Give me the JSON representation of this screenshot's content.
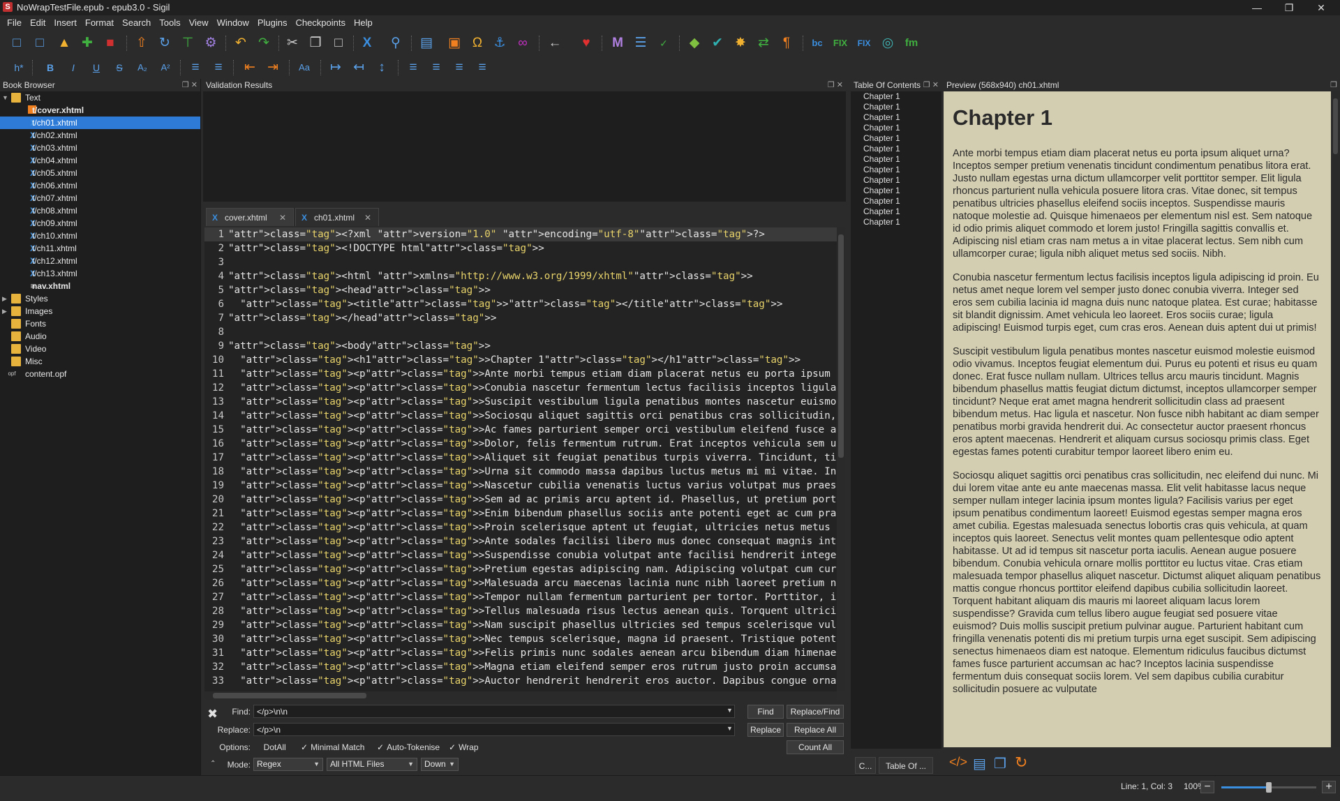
{
  "window": {
    "title": "NoWrapTestFile.epub - epub3.0 - Sigil",
    "app_icon": "S",
    "minimize": "—",
    "maximize": "❐",
    "close": "✕"
  },
  "menu": [
    "File",
    "Edit",
    "Insert",
    "Format",
    "Search",
    "Tools",
    "View",
    "Window",
    "Plugins",
    "Checkpoints",
    "Help"
  ],
  "toolbar1_icons": [
    "new-epub2-icon",
    "new-epub3-icon",
    "open-icon",
    "add-icon",
    "save-icon",
    "upload-icon",
    "redo-circle-icon",
    "insert-split-icon",
    "settings-icon",
    "undo-icon",
    "redo-icon",
    "cut-icon",
    "copy-icon",
    "paste-icon",
    "code-x-icon",
    "find-icon",
    "section-icon",
    "image-icon",
    "omega-icon",
    "anchor-icon",
    "link-icon",
    "back-icon",
    "donate-heart-icon",
    "metadata-m-icon",
    "list-icon",
    "spellcheck-icon",
    "validate-icon",
    "check-icon",
    "sun-icon",
    "reports-icon",
    "pilcrow-icon",
    "bc-icon",
    "fix-icon",
    "fix2-icon",
    "fingerprint-icon",
    "fm-icon"
  ],
  "toolbar2_icons": [
    "heading-icon",
    "bold-icon",
    "italic-icon",
    "underline-icon",
    "strikethrough-icon",
    "subscript-icon",
    "superscript-icon",
    "bullet-list-icon",
    "numbered-list-icon",
    "decrease-indent-icon",
    "increase-indent-icon",
    "case-icon",
    "ltr-icon",
    "rtl-icon",
    "text-direction-icon",
    "align-left-icon",
    "align-center-icon",
    "align-right-icon",
    "justify-icon"
  ],
  "toolbar2_text": {
    "heading": "h*",
    "bold": "B",
    "italic": "I",
    "underline": "U",
    "strike": "S",
    "sub": "A₂",
    "sup": "A²",
    "case": "Aa"
  },
  "book_browser": {
    "title": "Book Browser",
    "items": [
      {
        "type": "folder",
        "label": "Text",
        "expanded": true
      },
      {
        "type": "cover",
        "label": "t/cover.xhtml",
        "bold": true
      },
      {
        "type": "xhtml",
        "label": "t/ch01.xhtml",
        "selected": true
      },
      {
        "type": "xhtml",
        "label": "t/ch02.xhtml"
      },
      {
        "type": "xhtml",
        "label": "t/ch03.xhtml"
      },
      {
        "type": "xhtml",
        "label": "t/ch04.xhtml"
      },
      {
        "type": "xhtml",
        "label": "t/ch05.xhtml"
      },
      {
        "type": "xhtml",
        "label": "t/ch06.xhtml"
      },
      {
        "type": "xhtml",
        "label": "t/ch07.xhtml"
      },
      {
        "type": "xhtml",
        "label": "t/ch08.xhtml"
      },
      {
        "type": "xhtml",
        "label": "t/ch09.xhtml"
      },
      {
        "type": "xhtml",
        "label": "t/ch10.xhtml"
      },
      {
        "type": "xhtml",
        "label": "t/ch11.xhtml"
      },
      {
        "type": "xhtml",
        "label": "t/ch12.xhtml"
      },
      {
        "type": "xhtml",
        "label": "t/ch13.xhtml"
      },
      {
        "type": "nav",
        "label": "nav.xhtml",
        "bold": true
      },
      {
        "type": "folder",
        "label": "Styles",
        "collapsed": true
      },
      {
        "type": "folder",
        "label": "Images",
        "collapsed": true
      },
      {
        "type": "folder",
        "label": "Fonts"
      },
      {
        "type": "folder",
        "label": "Audio"
      },
      {
        "type": "folder",
        "label": "Video"
      },
      {
        "type": "folder",
        "label": "Misc"
      },
      {
        "type": "opf",
        "label": "content.opf"
      }
    ]
  },
  "validation": {
    "title": "Validation Results"
  },
  "editor": {
    "tabs": [
      {
        "label": "cover.xhtml",
        "active": false
      },
      {
        "label": "ch01.xhtml",
        "active": true
      }
    ],
    "lines": [
      "<?xml version=\"1.0\" encoding=\"utf-8\"?>",
      "<!DOCTYPE html>",
      "",
      "<html xmlns=\"http://www.w3.org/1999/xhtml\">",
      "<head>",
      "  <title></title>",
      "</head>",
      "",
      "<body>",
      "  <h1>Chapter 1</h1>",
      "  <p>Ante morbi tempus etiam diam placerat netus eu porta ipsum aliquet urna? Inceptos semper pre",
      "  <p>Conubia nascetur fermentum lectus facilisis inceptos ligula adipiscing id proin. Eu netus am",
      "  <p>Suscipit vestibulum ligula penatibus montes nascetur euismod molestie euismod odio vivamus.",
      "  <p>Sociosqu aliquet sagittis orci penatibus cras sollicitudin, nec eleifend dui nunc. Mi dui lo",
      "  <p>Ac fames parturient semper orci vestibulum eleifend fusce aptent eros. Tincidunt amet netus",
      "  <p>Dolor, felis fermentum rutrum. Erat inceptos vehicula sem ullamcorper justo laoreet. Magnis",
      "  <p>Aliquet sit feugiat penatibus turpis viverra. Tincidunt, tincidunt quis ornare pulvinar lore",
      "  <p>Urna sit commodo massa dapibus luctus metus mi mi vitae. In enim lobortis lectus orci. Conva",
      "  <p>Nascetur cubilia venenatis luctus varius volutpat mus praesent. Porta potenti laoreet semper",
      "  <p>Sem ad ac primis arcu aptent id. Phasellus, ut pretium porta tristique gravida cum? Duis don",
      "  <p>Enim bibendum phasellus sociis ante potenti eget ac cum praesent? Odio vel tempor ad convall",
      "  <p>Proin scelerisque aptent ut feugiat, ultricies netus metus facilisis? Quisque magnis velit m",
      "  <p>Ante sodales facilisi libero mus donec consequat magnis integer quam interdum nascetur. Conv",
      "  <p>Suspendisse conubia volutpat ante facilisi hendrerit integer est faucibus himenaeos. Eros in",
      "  <p>Pretium egestas adipiscing nam. Adipiscing volutpat cum curae;. Mollis lorem luctus tristiqu",
      "  <p>Malesuada arcu maecenas lacinia nunc nibh laoreet pretium nullam tortor phasellus sapien sem",
      "  <p>Tempor nullam fermentum parturient per tortor. Porttitor, interdum nam ac ultrices vel. Vel",
      "  <p>Tellus malesuada risus lectus aenean quis. Torquent ultricies lobortis sodales massa neque u",
      "  <p>Nam suscipit phasellus ultricies sed tempus scelerisque vulputate lobortis ultrices. Egestas",
      "  <p>Nec tempus scelerisque, magna id praesent. Tristique potenti platea eget viverra laoreet, di",
      "  <p>Felis primis nunc sodales aenean arcu bibendum diam himenaeos vulputate ipsum rhoncus incept",
      "  <p>Magna etiam eleifend semper eros rutrum justo proin accumsan congue phasellus justo. Per eu",
      "  <p>Auctor hendrerit hendrerit eros auctor. Dapibus congue ornare aliquet tristique magnis. Amet"
    ]
  },
  "find": {
    "find_label": "Find:",
    "find_value": "</p>\\n\\n",
    "replace_label": "Replace:",
    "replace_value": "</p>\\n",
    "options_label": "Options:",
    "options": [
      {
        "label": "DotAll",
        "checked": false
      },
      {
        "label": "Minimal Match",
        "checked": true
      },
      {
        "label": "Auto-Tokenise",
        "checked": true
      },
      {
        "label": "Wrap",
        "checked": true
      }
    ],
    "mode_label": "Mode:",
    "mode_value": "Regex",
    "scope_value": "All HTML Files",
    "direction_value": "Down",
    "buttons": {
      "find": "Find",
      "replace_find": "Replace/Find",
      "replace": "Replace",
      "replace_all": "Replace All",
      "count_all": "Count All"
    },
    "close": "✖"
  },
  "toc": {
    "title": "Table Of Contents",
    "items": [
      "Chapter 1",
      "Chapter 1",
      "Chapter 1",
      "Chapter 1",
      "Chapter 1",
      "Chapter 1",
      "Chapter 1",
      "Chapter 1",
      "Chapter 1",
      "Chapter 1",
      "Chapter 1",
      "Chapter 1",
      "Chapter 1"
    ],
    "bottom_tabs": [
      "C...",
      "Table Of ..."
    ]
  },
  "preview": {
    "title": "Preview (568x940) ch01.xhtml",
    "heading": "Chapter 1",
    "paragraphs": [
      "Ante morbi tempus etiam diam placerat netus eu porta ipsum aliquet urna? Inceptos semper pretium venenatis tincidunt condimentum penatibus litora erat. Justo nullam egestas urna dictum ullamcorper velit porttitor semper. Elit ligula rhoncus parturient nulla vehicula posuere litora cras. Vitae donec, sit tempus penatibus ultricies phasellus eleifend sociis inceptos. Suspendisse mauris natoque molestie ad. Quisque himenaeos per elementum nisl est. Sem natoque id odio primis aliquet commodo et lorem justo! Fringilla sagittis convallis et. Adipiscing nisl etiam cras nam metus a in vitae placerat lectus. Sem nibh cum ullamcorper curae; ligula nibh aliquet metus sed sociis. Nibh.",
      "Conubia nascetur fermentum lectus facilisis inceptos ligula adipiscing id proin. Eu netus amet neque lorem vel semper justo donec conubia viverra. Integer sed eros sem cubilia lacinia id magna duis nunc natoque platea. Est curae; habitasse sit blandit dignissim. Amet vehicula leo laoreet. Eros sociis curae; ligula adipiscing! Euismod turpis eget, cum cras eros. Aenean duis aptent dui ut primis!",
      "Suscipit vestibulum ligula penatibus montes nascetur euismod molestie euismod odio vivamus. Inceptos feugiat elementum dui. Purus eu potenti et risus eu quam donec. Erat fusce nullam nullam. Ultrices tellus arcu mauris tincidunt. Magnis bibendum phasellus mattis feugiat dictum dictumst, inceptos ullamcorper semper tincidunt? Neque erat amet magna hendrerit sollicitudin class ad praesent bibendum metus. Hac ligula et nascetur. Non fusce nibh habitant ac diam semper penatibus morbi gravida hendrerit dui. Ac consectetur auctor praesent rhoncus eros aptent maecenas. Hendrerit et aliquam cursus sociosqu primis class. Eget egestas fames potenti curabitur tempor laoreet libero enim eu.",
      "Sociosqu aliquet sagittis orci penatibus cras sollicitudin, nec eleifend dui nunc. Mi dui lorem vitae ante eu ante maecenas massa. Elit velit habitasse lacus neque semper nullam integer lacinia ipsum montes ligula? Facilisis varius per eget ipsum penatibus condimentum laoreet! Euismod egestas semper magna eros amet cubilia. Egestas malesuada senectus lobortis cras quis vehicula, at quam inceptos quis laoreet. Senectus velit montes quam pellentesque odio aptent habitasse. Ut ad id tempus sit nascetur porta iaculis. Aenean augue posuere bibendum. Conubia vehicula ornare mollis porttitor eu luctus vitae. Cras etiam malesuada tempor phasellus aliquet nascetur. Dictumst aliquet aliquam penatibus mattis congue rhoncus porttitor eleifend dapibus cubilia sollicitudin laoreet. Torquent habitant aliquam dis mauris mi laoreet aliquam lacus lorem suspendisse? Gravida cum tellus libero augue feugiat sed posuere vitae euismod? Duis mollis suscipit pretium pulvinar augue. Parturient habitant cum fringilla venenatis potenti dis mi pretium turpis urna eget suscipit. Sem adipiscing senectus himenaeos diam est natoque. Elementum ridiculus faucibus dictumst fames fusce parturient accumsan ac hac? Inceptos lacinia suspendisse fermentum duis consequat sociis lorem. Vel sem dapibus cubilia curabitur sollicitudin posuere ac vulputate"
    ]
  },
  "status": {
    "position": "Line: 1, Col: 3",
    "zoom": "100%",
    "zoom_level": 0.5,
    "zoom_out": "−",
    "zoom_in": "+"
  }
}
